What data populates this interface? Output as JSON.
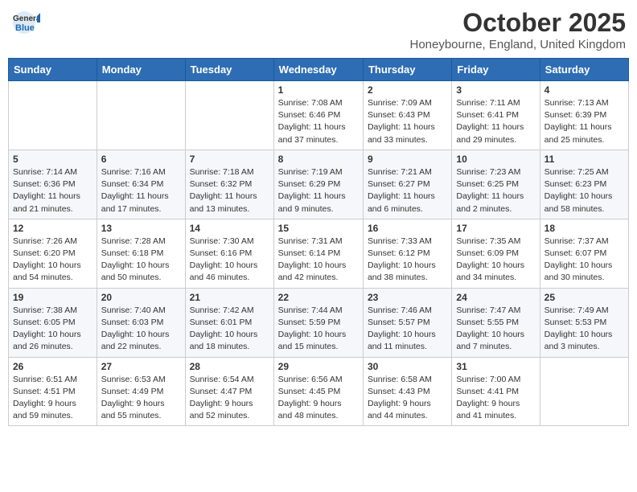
{
  "header": {
    "logo_general": "General",
    "logo_blue": "Blue",
    "month": "October 2025",
    "location": "Honeybourne, England, United Kingdom"
  },
  "days_of_week": [
    "Sunday",
    "Monday",
    "Tuesday",
    "Wednesday",
    "Thursday",
    "Friday",
    "Saturday"
  ],
  "weeks": [
    [
      {
        "day": "",
        "info": ""
      },
      {
        "day": "",
        "info": ""
      },
      {
        "day": "",
        "info": ""
      },
      {
        "day": "1",
        "info": "Sunrise: 7:08 AM\nSunset: 6:46 PM\nDaylight: 11 hours\nand 37 minutes."
      },
      {
        "day": "2",
        "info": "Sunrise: 7:09 AM\nSunset: 6:43 PM\nDaylight: 11 hours\nand 33 minutes."
      },
      {
        "day": "3",
        "info": "Sunrise: 7:11 AM\nSunset: 6:41 PM\nDaylight: 11 hours\nand 29 minutes."
      },
      {
        "day": "4",
        "info": "Sunrise: 7:13 AM\nSunset: 6:39 PM\nDaylight: 11 hours\nand 25 minutes."
      }
    ],
    [
      {
        "day": "5",
        "info": "Sunrise: 7:14 AM\nSunset: 6:36 PM\nDaylight: 11 hours\nand 21 minutes."
      },
      {
        "day": "6",
        "info": "Sunrise: 7:16 AM\nSunset: 6:34 PM\nDaylight: 11 hours\nand 17 minutes."
      },
      {
        "day": "7",
        "info": "Sunrise: 7:18 AM\nSunset: 6:32 PM\nDaylight: 11 hours\nand 13 minutes."
      },
      {
        "day": "8",
        "info": "Sunrise: 7:19 AM\nSunset: 6:29 PM\nDaylight: 11 hours\nand 9 minutes."
      },
      {
        "day": "9",
        "info": "Sunrise: 7:21 AM\nSunset: 6:27 PM\nDaylight: 11 hours\nand 6 minutes."
      },
      {
        "day": "10",
        "info": "Sunrise: 7:23 AM\nSunset: 6:25 PM\nDaylight: 11 hours\nand 2 minutes."
      },
      {
        "day": "11",
        "info": "Sunrise: 7:25 AM\nSunset: 6:23 PM\nDaylight: 10 hours\nand 58 minutes."
      }
    ],
    [
      {
        "day": "12",
        "info": "Sunrise: 7:26 AM\nSunset: 6:20 PM\nDaylight: 10 hours\nand 54 minutes."
      },
      {
        "day": "13",
        "info": "Sunrise: 7:28 AM\nSunset: 6:18 PM\nDaylight: 10 hours\nand 50 minutes."
      },
      {
        "day": "14",
        "info": "Sunrise: 7:30 AM\nSunset: 6:16 PM\nDaylight: 10 hours\nand 46 minutes."
      },
      {
        "day": "15",
        "info": "Sunrise: 7:31 AM\nSunset: 6:14 PM\nDaylight: 10 hours\nand 42 minutes."
      },
      {
        "day": "16",
        "info": "Sunrise: 7:33 AM\nSunset: 6:12 PM\nDaylight: 10 hours\nand 38 minutes."
      },
      {
        "day": "17",
        "info": "Sunrise: 7:35 AM\nSunset: 6:09 PM\nDaylight: 10 hours\nand 34 minutes."
      },
      {
        "day": "18",
        "info": "Sunrise: 7:37 AM\nSunset: 6:07 PM\nDaylight: 10 hours\nand 30 minutes."
      }
    ],
    [
      {
        "day": "19",
        "info": "Sunrise: 7:38 AM\nSunset: 6:05 PM\nDaylight: 10 hours\nand 26 minutes."
      },
      {
        "day": "20",
        "info": "Sunrise: 7:40 AM\nSunset: 6:03 PM\nDaylight: 10 hours\nand 22 minutes."
      },
      {
        "day": "21",
        "info": "Sunrise: 7:42 AM\nSunset: 6:01 PM\nDaylight: 10 hours\nand 18 minutes."
      },
      {
        "day": "22",
        "info": "Sunrise: 7:44 AM\nSunset: 5:59 PM\nDaylight: 10 hours\nand 15 minutes."
      },
      {
        "day": "23",
        "info": "Sunrise: 7:46 AM\nSunset: 5:57 PM\nDaylight: 10 hours\nand 11 minutes."
      },
      {
        "day": "24",
        "info": "Sunrise: 7:47 AM\nSunset: 5:55 PM\nDaylight: 10 hours\nand 7 minutes."
      },
      {
        "day": "25",
        "info": "Sunrise: 7:49 AM\nSunset: 5:53 PM\nDaylight: 10 hours\nand 3 minutes."
      }
    ],
    [
      {
        "day": "26",
        "info": "Sunrise: 6:51 AM\nSunset: 4:51 PM\nDaylight: 9 hours\nand 59 minutes."
      },
      {
        "day": "27",
        "info": "Sunrise: 6:53 AM\nSunset: 4:49 PM\nDaylight: 9 hours\nand 55 minutes."
      },
      {
        "day": "28",
        "info": "Sunrise: 6:54 AM\nSunset: 4:47 PM\nDaylight: 9 hours\nand 52 minutes."
      },
      {
        "day": "29",
        "info": "Sunrise: 6:56 AM\nSunset: 4:45 PM\nDaylight: 9 hours\nand 48 minutes."
      },
      {
        "day": "30",
        "info": "Sunrise: 6:58 AM\nSunset: 4:43 PM\nDaylight: 9 hours\nand 44 minutes."
      },
      {
        "day": "31",
        "info": "Sunrise: 7:00 AM\nSunset: 4:41 PM\nDaylight: 9 hours\nand 41 minutes."
      },
      {
        "day": "",
        "info": ""
      }
    ]
  ]
}
